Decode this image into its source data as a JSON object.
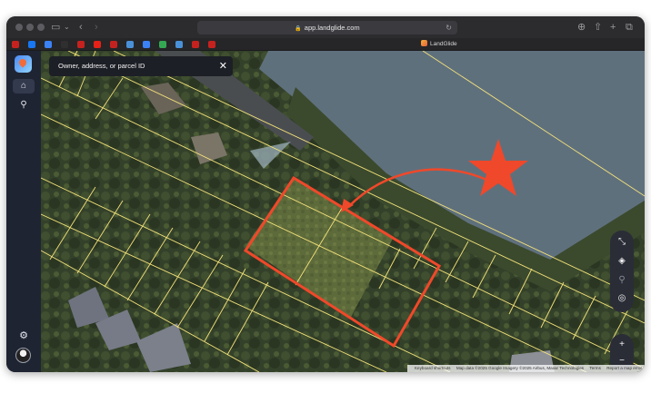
{
  "browser": {
    "url": "app.landglide.com",
    "tab_title": "LandGlide",
    "bookmarks": [
      {
        "name": "gmail",
        "color": "#c5221f"
      },
      {
        "name": "facebook",
        "color": "#1877f2"
      },
      {
        "name": "circle-app",
        "color": "#3b82f6"
      },
      {
        "name": "terminal-app",
        "color": "#2f2f2f"
      },
      {
        "name": "gmail",
        "color": "#c5221f"
      },
      {
        "name": "youtube",
        "color": "#e62117"
      },
      {
        "name": "gmail",
        "color": "#c5221f"
      },
      {
        "name": "photo-app",
        "color": "#4a90d9"
      },
      {
        "name": "circle-app",
        "color": "#3b82f6"
      },
      {
        "name": "chrome",
        "color": "#34a853"
      },
      {
        "name": "photo-app",
        "color": "#4a90d9"
      },
      {
        "name": "gmail",
        "color": "#c5221f"
      },
      {
        "name": "gmail",
        "color": "#c5221f"
      }
    ]
  },
  "app": {
    "search_placeholder": "Owner, address, or parcel ID",
    "sidebar_items": [
      "home-icon",
      "location-pin-icon"
    ],
    "sidebar_bottom": [
      "gear-icon",
      "avatar"
    ]
  },
  "map": {
    "attribution": [
      "Keyboard shortcuts",
      "Map data ©2025 Google Imagery ©2025 Airbus, Maxar Technologies",
      "Terms",
      "Report a map error"
    ],
    "controls": [
      "expand-icon",
      "layers-icon",
      "location-pin-icon",
      "my-location-icon",
      "zoom-in-icon",
      "zoom-out-icon"
    ],
    "colors": {
      "parcel_lines": "#f4e27a",
      "highlight": "#f0482a",
      "water": "#5f707d"
    }
  }
}
